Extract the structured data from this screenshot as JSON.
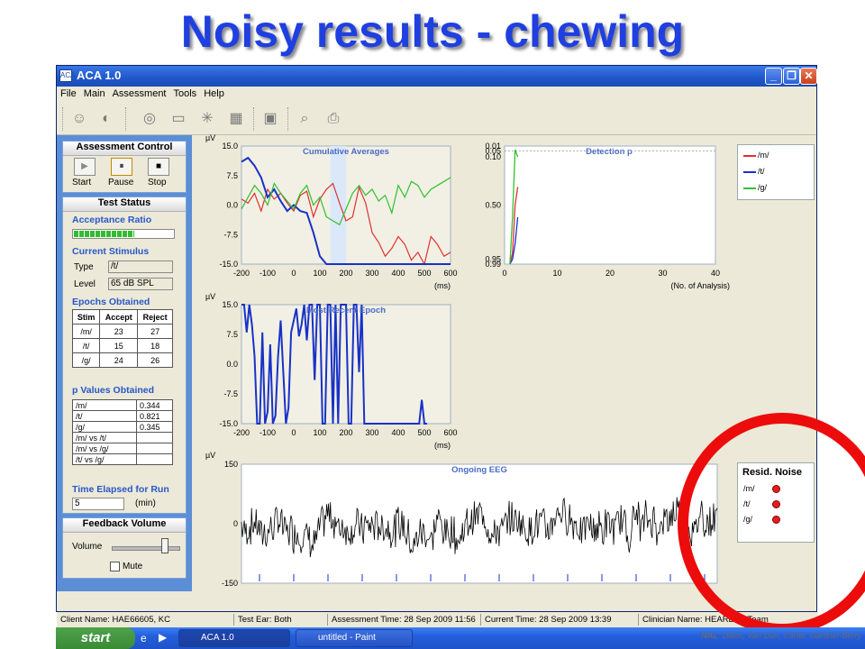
{
  "slide": {
    "title": "Noisy results - chewing",
    "credit_strong": "NAL",
    "credit_rest": ": Dillon, Van Dun, Carter, Gardner-Berry"
  },
  "window": {
    "title": "ACA 1.0",
    "icon": "ACA"
  },
  "menu": [
    "File",
    "Main",
    "Assessment",
    "Tools",
    "Help"
  ],
  "toolbar_icons": [
    "user-icon",
    "ear-icon",
    "target-icon",
    "monitor-icon",
    "probe-icon",
    "checklist-icon",
    "save-icon",
    "zoom-icon",
    "print-icon"
  ],
  "assessment_control": {
    "header": "Assessment Control",
    "buttons": [
      {
        "label": "Start",
        "glyph": "▶"
      },
      {
        "label": "Pause",
        "glyph": "⏸"
      },
      {
        "label": "Stop",
        "glyph": "■"
      }
    ]
  },
  "test_status": {
    "header": "Test Status",
    "acceptance_ratio_label": "Acceptance Ratio",
    "acceptance_ratio": 0.6,
    "current_stimulus_label": "Current Stimulus",
    "type_label": "Type",
    "type_value": "/t/",
    "level_label": "Level",
    "level_value": "65 dB SPL",
    "epochs_label": "Epochs Obtained",
    "epochs_headers": [
      "Stim",
      "Accept",
      "Reject"
    ],
    "epochs_rows": [
      [
        "/m/",
        "23",
        "27"
      ],
      [
        "/t/",
        "15",
        "18"
      ],
      [
        "/g/",
        "24",
        "26"
      ]
    ],
    "pvalues_label": "p Values Obtained",
    "pvalues_rows": [
      [
        "/m/",
        "0.344"
      ],
      [
        "/t/",
        "0.821"
      ],
      [
        "/g/",
        "0.345"
      ],
      [
        "/m/ vs /t/",
        ""
      ],
      [
        "/m/ vs /g/",
        ""
      ],
      [
        "/t/ vs /g/",
        ""
      ]
    ],
    "time_label": "Time Elapsed for Run",
    "time_value": "5",
    "time_unit": "(min)"
  },
  "feedback": {
    "header": "Feedback Volume",
    "volume_label": "Volume",
    "volume_level": 0.8,
    "mute_label": "Mute"
  },
  "status_bar": {
    "client": "Client Name: HAE66605, KC",
    "ear": "Test Ear: Both",
    "assessment_time": "Assessment Time: 28 Sep 2009 11:56",
    "current_time": "Current Time: 28 Sep 2009 13:39",
    "clinician": "Clinician Name: HEARLab, Team"
  },
  "taskbar": {
    "start": "start",
    "tasks": [
      "ACA 1.0",
      "untitled - Paint"
    ]
  },
  "legend": {
    "entries": [
      "/m/",
      "/t/",
      "/g/"
    ]
  },
  "resid": {
    "header": "Resid. Noise",
    "entries": [
      "/m/",
      "/t/",
      "/g/"
    ]
  },
  "colors": {
    "m": "#e03030",
    "t": "#1832c8",
    "g": "#30c030",
    "eeg": "#000000"
  },
  "chart_data": [
    {
      "type": "line",
      "title": "Cumulative Averages",
      "unit": "µV",
      "xlabel": "(ms)",
      "xlim": [
        -200,
        600
      ],
      "ylim": [
        -15,
        15
      ],
      "xticks": [
        -200,
        -100,
        0,
        100,
        200,
        300,
        400,
        500,
        600
      ],
      "yticks": [
        "15.0",
        "7.5",
        "0.0",
        "-7.5",
        "-15.0"
      ],
      "x": [
        -200,
        -175,
        -150,
        -125,
        -100,
        -75,
        -50,
        -25,
        0,
        25,
        50,
        75,
        100,
        125,
        150,
        175,
        200,
        225,
        250,
        275,
        300,
        325,
        350,
        375,
        400,
        425,
        450,
        475,
        500,
        525,
        550,
        575,
        600
      ],
      "series": [
        {
          "name": "/m/",
          "values": [
            1.5,
            0.5,
            3,
            -1.5,
            4,
            1.5,
            3,
            0.5,
            -1.5,
            2.5,
            3.5,
            -3,
            1.5,
            4,
            5.5,
            0.5,
            -4,
            -3,
            4.5,
            0.5,
            -7,
            -9.5,
            -13,
            -11,
            -8,
            -10,
            -14,
            -12,
            -15,
            -8,
            -10,
            -13,
            -12
          ]
        },
        {
          "name": "/t/",
          "values": [
            11,
            12,
            10,
            7,
            2,
            4,
            1,
            -1.5,
            0,
            -1.5,
            -2,
            -7,
            -13,
            -15,
            -15,
            -15,
            -15,
            -15,
            -15,
            -15,
            -15,
            -15,
            -15,
            -15,
            -15,
            -15,
            -15,
            -15,
            -15,
            -15,
            -15,
            -15,
            -15
          ]
        },
        {
          "name": "/g/",
          "values": [
            -1,
            2,
            5,
            3,
            0,
            5.5,
            3,
            1,
            -1,
            3,
            5,
            0,
            2,
            -3,
            -4,
            -5,
            -1,
            3,
            5,
            2.5,
            4,
            1,
            2.5,
            -2,
            5,
            2,
            6,
            5,
            2,
            4,
            5,
            6,
            7
          ]
        }
      ],
      "highlight": [
        140,
        200
      ]
    },
    {
      "type": "line",
      "title": "Detection p",
      "xlabel": "(No. of Analysis)",
      "xlim": [
        0,
        40
      ],
      "xticks": [
        0,
        10,
        20,
        30,
        40
      ],
      "ylim": [
        0.99,
        0.01
      ],
      "yticks": [
        "0.01",
        "0.05",
        "0.10",
        "0.50",
        "0.95",
        "0.99"
      ],
      "threshold": 0.05,
      "x": [
        1,
        1.5,
        2,
        2.5
      ],
      "series": [
        {
          "name": "/m/",
          "values": [
            0.99,
            0.9,
            0.5,
            0.35
          ]
        },
        {
          "name": "/t/",
          "values": [
            0.99,
            0.95,
            0.82,
            0.6
          ]
        },
        {
          "name": "/g/",
          "values": [
            0.99,
            0.6,
            0.04,
            0.1
          ]
        }
      ]
    },
    {
      "type": "line",
      "title": "Most Recent Epoch",
      "unit": "µV",
      "xlabel": "(ms)",
      "xlim": [
        -200,
        600
      ],
      "ylim": [
        -15,
        15
      ],
      "xticks": [
        -200,
        -100,
        0,
        100,
        200,
        300,
        400,
        500,
        600
      ],
      "yticks": [
        "15.0",
        "7.5",
        "0.0",
        "-7.5",
        "-15.0"
      ],
      "x": [
        -200,
        -190,
        -180,
        -170,
        -160,
        -150,
        -140,
        -130,
        -120,
        -110,
        -100,
        -90,
        -80,
        -70,
        -60,
        -50,
        -40,
        -30,
        -20,
        -10,
        0,
        10,
        20,
        30,
        40,
        50,
        60,
        70,
        80,
        90,
        100,
        110,
        120,
        130,
        140,
        150,
        160,
        170,
        180,
        190,
        200,
        210,
        220,
        230,
        240,
        250,
        260,
        270,
        280,
        480,
        490,
        500,
        510
      ],
      "series": [
        {
          "name": "/t/",
          "values": [
            15,
            15,
            8,
            15,
            10,
            2,
            -15,
            -15,
            8,
            -15,
            -12,
            5,
            -15,
            -13,
            2,
            11,
            -2,
            -15,
            -11,
            8,
            11,
            14,
            7,
            10,
            15,
            6,
            15,
            15,
            -4,
            15,
            15,
            -15,
            -15,
            15,
            15,
            -15,
            15,
            -15,
            15,
            15,
            15,
            -15,
            -15,
            15,
            15,
            -2,
            15,
            -15,
            -15,
            -15,
            -9,
            -15,
            -15
          ]
        }
      ]
    },
    {
      "type": "line",
      "title": "Ongoing EEG",
      "unit": "µV",
      "ylim": [
        -150,
        150
      ],
      "yticks": [
        "150",
        "0",
        "-150"
      ],
      "series": [
        {
          "name": "EEG",
          "sample_count": 520,
          "amplitude": 60
        }
      ]
    }
  ]
}
